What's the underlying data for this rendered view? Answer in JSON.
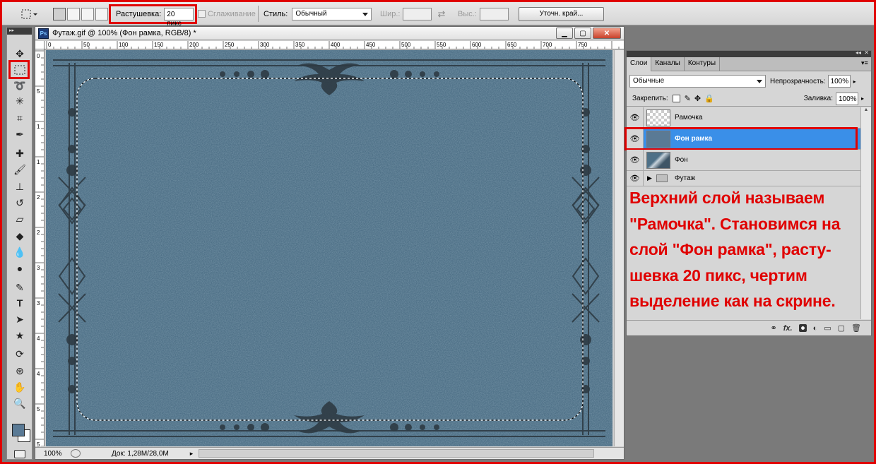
{
  "options_bar": {
    "feather_label": "Растушевка:",
    "feather_value": "20 пикс",
    "antialias_label": "Сглаживание",
    "style_label": "Стиль:",
    "style_value": "Обычный",
    "width_label": "Шир.:",
    "height_label": "Выс.:",
    "refine_edge_button": "Уточн. край..."
  },
  "document": {
    "title": "Футаж.gif @ 100% (Фон рамка, RGB/8) *",
    "ruler_h_ticks": [
      "0",
      "50",
      "100",
      "150",
      "200",
      "250",
      "300",
      "350",
      "400",
      "450",
      "500",
      "550",
      "600",
      "650",
      "700",
      "750"
    ],
    "ruler_v_ticks": [
      "0",
      "5",
      "1",
      "1",
      "2",
      "2",
      "3",
      "3",
      "4",
      "4",
      "5",
      "5"
    ],
    "zoom": "100%",
    "doc_size": "Док: 1,28M/28,0M",
    "canvas_color": "#4f7288"
  },
  "layers_panel": {
    "tabs": [
      "Слои",
      "Каналы",
      "Контуры"
    ],
    "blend_mode": "Обычные",
    "opacity_label": "Непрозрачность:",
    "opacity_value": "100%",
    "lock_label": "Закрепить:",
    "fill_label": "Заливка:",
    "fill_value": "100%",
    "layers": [
      {
        "name": "Рамочка",
        "thumb": "transparent",
        "active": false
      },
      {
        "name": "Фон рамка",
        "thumb": "solid",
        "active": true
      },
      {
        "name": "Фон",
        "thumb": "image",
        "active": false
      },
      {
        "name": "Футаж",
        "thumb": "folder",
        "active": false
      }
    ],
    "footer_icons": [
      "link-icon",
      "fx-icon",
      "mask-icon",
      "adjustment-icon",
      "group-icon",
      "new-layer-icon",
      "trash-icon"
    ],
    "footer_fx": "fx."
  },
  "annotation": {
    "text": "Верхний слой называем\n\"Рамочка\". Становимся на\nслой \"Фон рамка\", расту-\nшевка 20 пикс, чертим\nвыделение как на скрине."
  },
  "colors": {
    "highlight": "#e00000",
    "active_layer": "#3a8fe8",
    "foreground": "#5a7a95",
    "background": "#ffffff"
  },
  "toolbox": {
    "tools": [
      "move-tool",
      "marquee-tool",
      "lasso-tool",
      "magic-wand-tool",
      "crop-tool",
      "eyedropper-tool",
      "healing-tool",
      "brush-tool",
      "stamp-tool",
      "history-brush-tool",
      "eraser-tool",
      "bucket-tool",
      "blur-tool",
      "dodge-tool",
      "pen-tool",
      "type-tool",
      "path-select-tool",
      "shape-tool",
      "3d-rotate-tool",
      "3d-orbit-tool",
      "hand-tool",
      "zoom-tool"
    ]
  }
}
